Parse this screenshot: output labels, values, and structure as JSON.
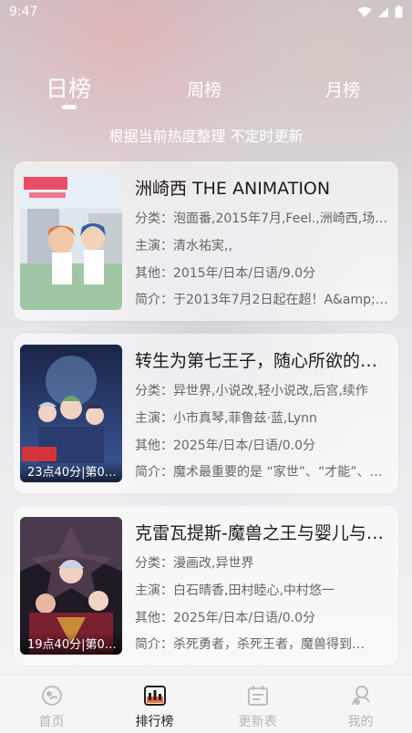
{
  "status_bar": {
    "time": "9:47"
  },
  "tabs": {
    "day": "日榜",
    "week": "周榜",
    "month": "月榜"
  },
  "subtitle": "根据当前热度整理 不定时更新",
  "cards": [
    {
      "title": "洲崎西 THE ANIMATION",
      "category": "分类：泡面番,2015年7月,Feel.,洲崎西,场…",
      "cast": "主演：清水祐実,,",
      "other": "其他：2015年/日本/日语/9.0分",
      "intro": "简介：于2013年7月2日起在超！A&amp;…",
      "cover_badge": ""
    },
    {
      "title": "转生为第七王子，随心所欲的…",
      "category": "分类：异世界,小说改,轻小说改,后宫,续作",
      "cast": "主演：小市真琴,菲鲁兹·蓝,Lynn",
      "other": "其他：2025年/日本/日语/0.0分",
      "intro": "简介：魔术最重要的是 “家世”、“才能”、…",
      "cover_badge": "23点40分|第0…"
    },
    {
      "title": "克雷瓦提斯-魔兽之王与婴儿与…",
      "category": "分类：漫画改,异世界",
      "cast": "主演：白石晴香,田村睦心,中村悠一",
      "other": "其他：2025年/日本/日语/0.0分",
      "intro": "简介：杀死勇者，杀死王者，魔兽得到…",
      "cover_badge": "19点40分|第0…"
    }
  ],
  "bottom_nav": {
    "home": "首页",
    "rank": "排行榜",
    "schedule": "更新表",
    "mine": "我的"
  }
}
